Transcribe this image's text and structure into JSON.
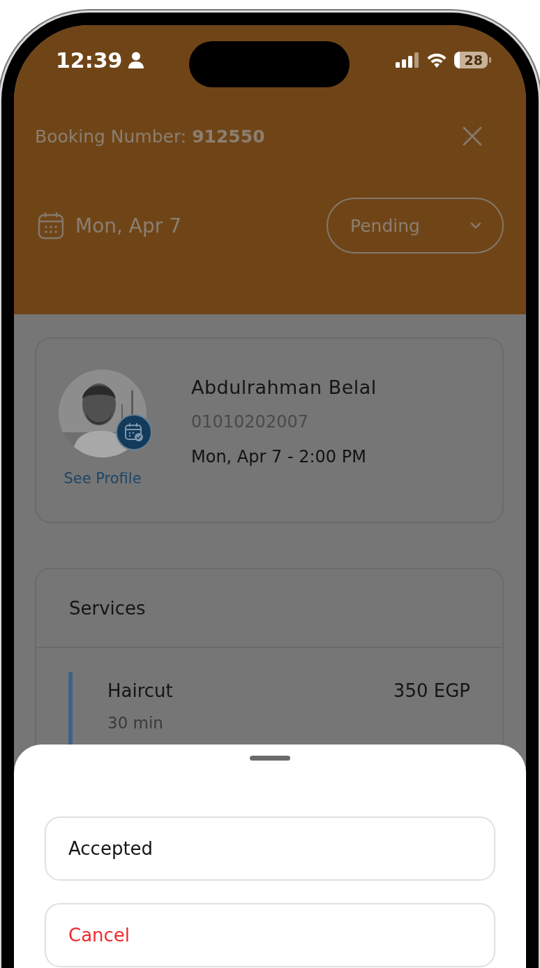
{
  "status_bar": {
    "time": "12:39",
    "battery": "28"
  },
  "header": {
    "booking_number": "Booking Number: **912550**",
    "date": "Mon, Apr 7",
    "status_dropdown": {
      "value": "Pending"
    }
  },
  "customer": {
    "name": "Abdulrahman Belal",
    "phone": "01010202007",
    "appointment": "Mon, Apr 7 - 2:00 PM",
    "profile_link": "See Profile"
  },
  "services": {
    "title": "Services",
    "items": [
      {
        "name": "Haircut",
        "price": "350 EGP",
        "duration": "30 min"
      }
    ]
  },
  "status_sheet": {
    "options": [
      {
        "label": "Accepted",
        "kind": "normal"
      },
      {
        "label": "Cancel",
        "kind": "destructive"
      }
    ]
  }
}
